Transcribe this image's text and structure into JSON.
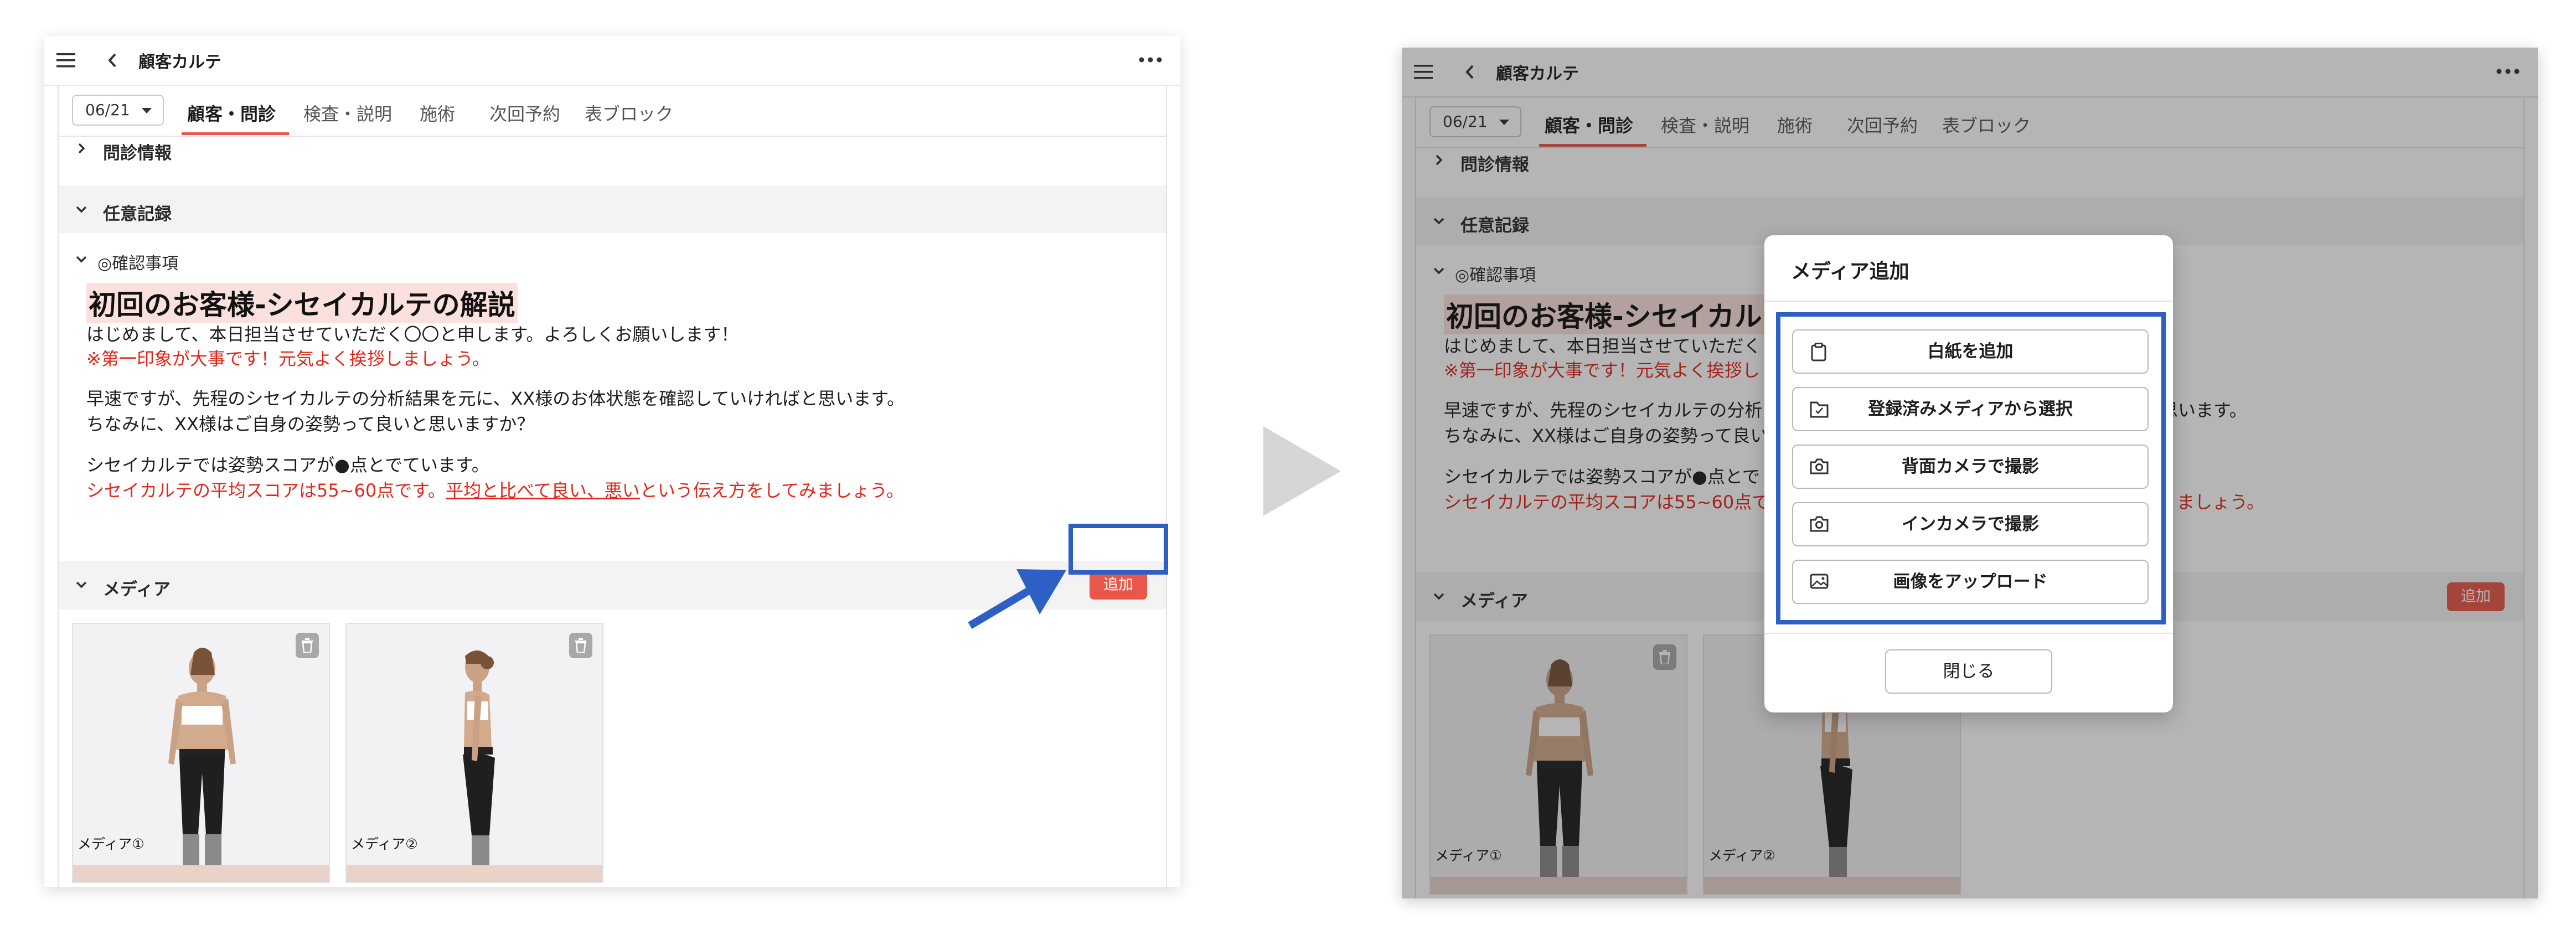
{
  "app": {
    "title": "顧客カルテ",
    "date_select": "06/21",
    "tabs": [
      {
        "label": "顧客・問診",
        "active": true
      },
      {
        "label": "検査・説明",
        "active": false
      },
      {
        "label": "施術",
        "active": false
      },
      {
        "label": "次回予約",
        "active": false
      },
      {
        "label": "表ブロック",
        "active": false
      }
    ]
  },
  "sections": {
    "interview": "問診情報",
    "free_record": "任意記録",
    "confirm": "◎確認事項",
    "media": "メディア"
  },
  "doc": {
    "heading": "初回のお客様-シセイカルテの解説",
    "line1": "はじめまして、本日担当させていただく〇〇と申します。よろしくお願いします！",
    "line2_red": "※第一印象が大事です！元気よく挨拶しましょう。",
    "line3": "早速ですが、先程のシセイカルテの分析結果を元に、XX様のお体状態を確認していければと思います。",
    "line4": "ちなみに、XX様はご自身の姿勢って良いと思いますか？",
    "line5": "シセイカルテでは姿勢スコアが●点とでています。",
    "line6_part1": "シセイカルテの平均スコアは55~60点です。",
    "line6_link": "平均と比べて良い、悪い",
    "line6_part2": "という伝え方をしてみましょう。",
    "right_partial": {
      "heading": "初回のお客様-シセイカルテ",
      "line1": "はじめまして、本日担当させていただく",
      "line2_red": "※第一印象が大事です！元気よく挨拶し",
      "line3": "早速ですが、先程のシセイカルテの分析",
      "line3_end": "思います。",
      "line4": "ちなみに、XX様はご自身の姿勢って良い",
      "line5": "シセイカルテでは姿勢スコアが●点とで",
      "line6": "シセイカルテの平均スコアは55~60点で",
      "line6_end": "ましょう。"
    }
  },
  "media": {
    "add_label": "追加",
    "items": [
      {
        "label": "メディア①"
      },
      {
        "label": "メディア②"
      }
    ]
  },
  "modal": {
    "title": "メディア追加",
    "options": [
      {
        "label": "白紙を追加",
        "icon": "clipboard-icon"
      },
      {
        "label": "登録済みメディアから選択",
        "icon": "folder-icon"
      },
      {
        "label": "背面カメラで撮影",
        "icon": "camera-icon"
      },
      {
        "label": "インカメラで撮影",
        "icon": "camera-icon"
      },
      {
        "label": "画像をアップロード",
        "icon": "image-icon"
      }
    ],
    "close_label": "閉じる"
  },
  "colors": {
    "accent_red": "#e8574a",
    "annotation_blue": "#2d5fc4",
    "highlight_pink": "#fbe1de"
  }
}
